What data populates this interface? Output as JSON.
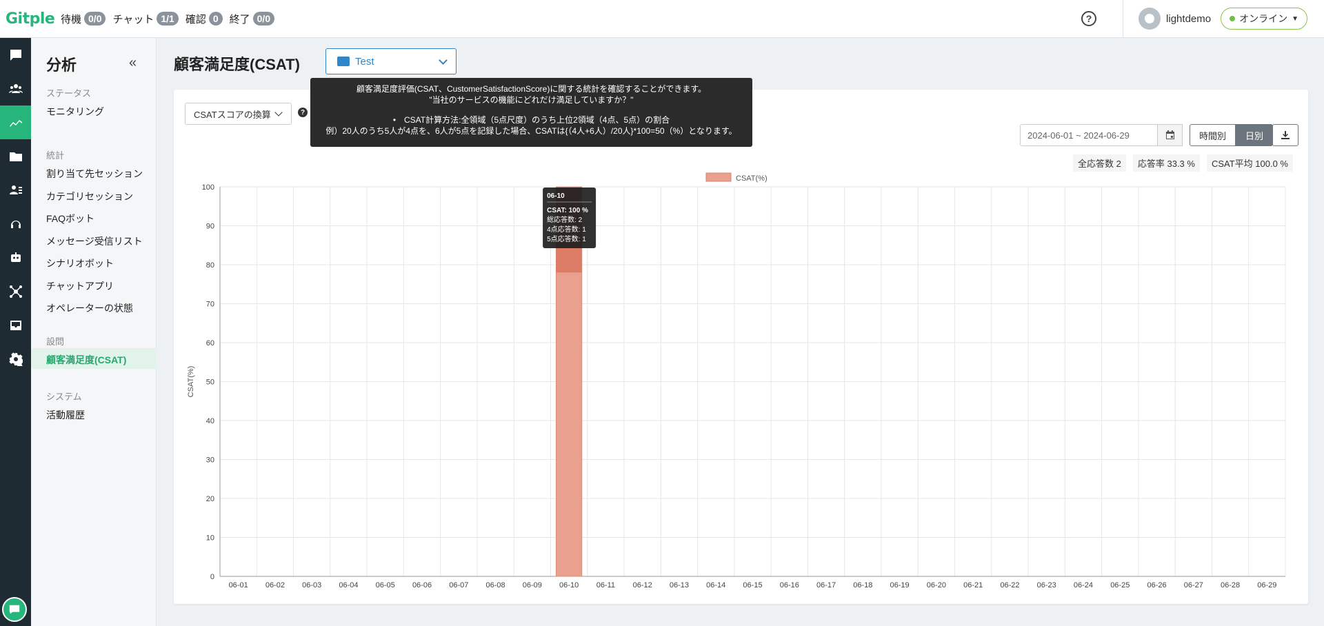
{
  "topbar": {
    "logo": "Gitple",
    "statuses": [
      {
        "label": "待機",
        "badge": "0/0"
      },
      {
        "label": "チャット",
        "badge": "1/1"
      },
      {
        "label": "確認",
        "badge": "0"
      },
      {
        "label": "終了",
        "badge": "0/0"
      }
    ],
    "help": "?",
    "username": "lightdemo",
    "online_label": "オンライン",
    "online_color": "#6cc04a"
  },
  "rail": {
    "icons": [
      "chat-icon",
      "users-icon",
      "analytics-icon",
      "folder-icon",
      "contact-icon",
      "headset-icon",
      "bot-icon",
      "network-icon",
      "inbox-icon",
      "gear-icon"
    ],
    "active_index": 2,
    "accent": "#26b67c"
  },
  "sidebar": {
    "title": "分析",
    "collapse": "«",
    "sections": [
      {
        "title": "ステータス",
        "items": [
          "モニタリング"
        ]
      },
      {
        "title": "統計",
        "items": [
          "割り当て先セッション",
          "カテゴリセッション",
          "FAQボット",
          "メッセージ受信リスト",
          "シナリオボット",
          "チャットアプリ",
          "オペレーターの状態"
        ]
      },
      {
        "title": "設問",
        "items": [
          "顧客満足度(CSAT)"
        ]
      },
      {
        "title": "システム",
        "items": [
          "活動履歴"
        ]
      }
    ],
    "active_item": "顧客満足度(CSAT)"
  },
  "main": {
    "title": "顧客満足度(CSAT)",
    "dropdown": "Test",
    "csat_select": "CSATスコアの換算",
    "info_tooltip": {
      "line1": "顧客満足度評価(CSAT、CustomerSatisfactionScore)に関する統計を確認することができます。",
      "line2": "\"当社のサービスの機能にどれだけ満足していますか？\"",
      "line3": "•　CSAT計算方法:全領域（5点尺度）のうち上位2領域（4点、5点）の割合",
      "line4": "例）20人のうち5人が4点を、6人が5点を記録した場合、CSATは{（4人+6人）/20人}*100=50（%）となります。"
    },
    "date_range": "2024-06-01 ~ 2024-06-29",
    "seg_hourly": "時間別",
    "seg_daily": "日別",
    "stats": [
      "全応答数 2",
      "応答率 33.3 %",
      "CSAT平均 100.0 %"
    ]
  },
  "chart_data": {
    "type": "bar",
    "title": "",
    "xlabel": "",
    "ylabel": "CSAT(%)",
    "ylim": [
      0,
      100
    ],
    "yticks": [
      0,
      10,
      20,
      30,
      40,
      50,
      60,
      70,
      80,
      90,
      100
    ],
    "grid": true,
    "legend_position": "top-center",
    "categories": [
      "06-01",
      "06-02",
      "06-03",
      "06-04",
      "06-05",
      "06-06",
      "06-07",
      "06-08",
      "06-09",
      "06-10",
      "06-11",
      "06-12",
      "06-13",
      "06-14",
      "06-15",
      "06-16",
      "06-17",
      "06-18",
      "06-19",
      "06-20",
      "06-21",
      "06-22",
      "06-23",
      "06-24",
      "06-25",
      "06-26",
      "06-27",
      "06-28",
      "06-29"
    ],
    "series": [
      {
        "name": "CSAT(%)",
        "color": "#e9a08f",
        "values": [
          0,
          0,
          0,
          0,
          0,
          0,
          0,
          0,
          0,
          100,
          0,
          0,
          0,
          0,
          0,
          0,
          0,
          0,
          0,
          0,
          0,
          0,
          0,
          0,
          0,
          0,
          0,
          0,
          0
        ]
      }
    ],
    "tooltip": {
      "title": "06-10",
      "lines": [
        "CSAT: 100 %",
        "総応答数: 2",
        "4点応答数: 1",
        "5点応答数: 1"
      ]
    }
  }
}
